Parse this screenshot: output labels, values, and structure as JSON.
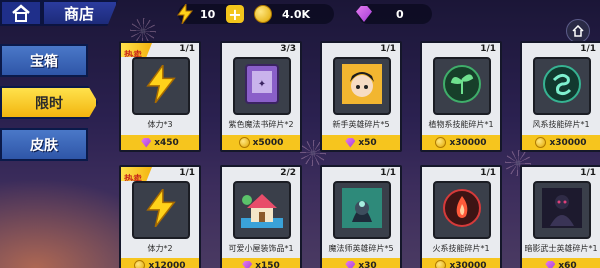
{
  "header": {
    "title": "商店",
    "energy": "10",
    "gold": "4.0K",
    "gems": "0"
  },
  "sidebar": {
    "tabs": [
      {
        "label": "宝箱",
        "active": false
      },
      {
        "label": "限时",
        "active": true
      },
      {
        "label": "皮肤",
        "active": false
      }
    ]
  },
  "shop": {
    "hot_label": "热卖",
    "items": [
      {
        "name": "体力*3",
        "stock": "1/1",
        "price": "x450",
        "currency": "gem",
        "icon": "lightning-icon",
        "hot": true
      },
      {
        "name": "紫色魔法书碎片*2",
        "stock": "3/3",
        "price": "x5000",
        "currency": "gold",
        "icon": "book-icon",
        "hot": false
      },
      {
        "name": "新手英雄碎片*5",
        "stock": "1/1",
        "price": "x50",
        "currency": "gem",
        "icon": "hero-portrait-icon",
        "hot": false
      },
      {
        "name": "植物系技能碎片*1",
        "stock": "1/1",
        "price": "x30000",
        "currency": "gold",
        "icon": "sprout-icon",
        "hot": false
      },
      {
        "name": "风系技能碎片*1",
        "stock": "1/1",
        "price": "x30000",
        "currency": "gold",
        "icon": "wind-icon",
        "hot": false
      },
      {
        "name": "体力*2",
        "stock": "1/1",
        "price": "x12000",
        "currency": "gold",
        "icon": "lightning-icon",
        "hot": true
      },
      {
        "name": "可爱小屋装饰品*1",
        "stock": "2/2",
        "price": "x150",
        "currency": "gem",
        "icon": "house-icon",
        "hot": false
      },
      {
        "name": "魔法师英雄碎片*5",
        "stock": "1/1",
        "price": "x30",
        "currency": "gem",
        "icon": "mage-portrait-icon",
        "hot": false
      },
      {
        "name": "火系技能碎片*1",
        "stock": "1/1",
        "price": "x30000",
        "currency": "gold",
        "icon": "fire-icon",
        "hot": false
      },
      {
        "name": "暗影武士英雄碎片*1",
        "stock": "1/1",
        "price": "x60",
        "currency": "gem",
        "icon": "shadow-hero-icon",
        "hot": false
      }
    ]
  }
}
